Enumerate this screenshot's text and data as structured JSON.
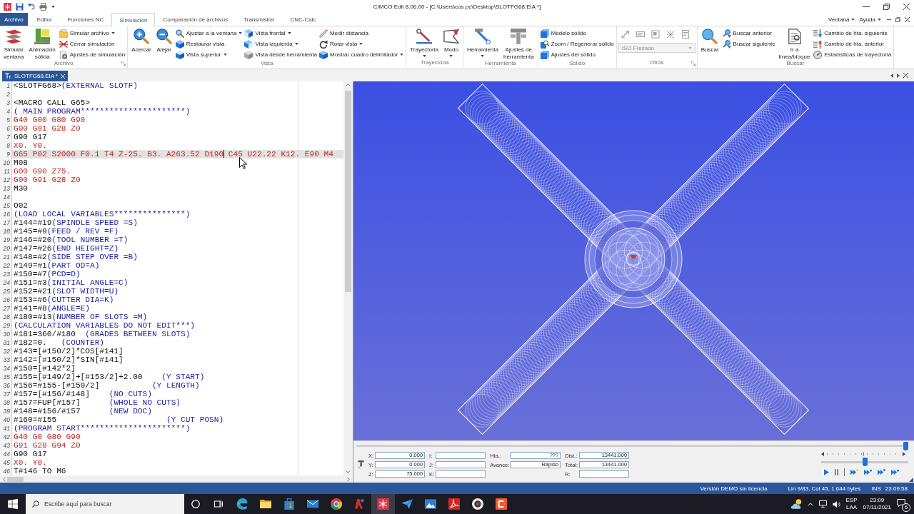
{
  "title_bar": {
    "title": "CIMCO Edit 8.06.00 - [C:\\Users\\cos pc\\Desktop\\SLOTFG68.EIA *]"
  },
  "ribbon": {
    "file_tab": "Archivo",
    "tabs": [
      {
        "label": "Editor",
        "selected": false
      },
      {
        "label": "Funciones NC",
        "selected": false
      },
      {
        "label": "Simulación",
        "selected": true
      },
      {
        "label": "Comparación de archivos",
        "selected": false
      },
      {
        "label": "Transmisión",
        "selected": false
      },
      {
        "label": "CNC-Calc",
        "selected": false
      }
    ],
    "menus": [
      {
        "label": "Ventana"
      },
      {
        "label": "Ayuda"
      }
    ],
    "groups": [
      {
        "label": "Archivo",
        "launcher": true,
        "items": [
          {
            "kind": "large",
            "label": "Simular ventana",
            "dropdown": false
          },
          {
            "kind": "large",
            "label": "Animación sólida",
            "dropdown": false
          },
          {
            "kind": "stack",
            "buttons": [
              {
                "label": "Simular archivo",
                "dropdown": true
              },
              {
                "label": "Cerrar simulación",
                "dropdown": false
              },
              {
                "label": "Ajustes de simulación",
                "dropdown": false
              }
            ]
          }
        ]
      },
      {
        "label": "Vista",
        "launcher": false,
        "items": [
          {
            "kind": "large",
            "label": "Acercar",
            "dropdown": false
          },
          {
            "kind": "large",
            "label": "Alejar",
            "dropdown": false
          },
          {
            "kind": "stack",
            "buttons": [
              {
                "label": "Ajustar a la ventana",
                "dropdown": true
              },
              {
                "label": "Restaurar vista",
                "dropdown": false
              },
              {
                "label": "Vista superior",
                "dropdown": true
              }
            ]
          },
          {
            "kind": "stack",
            "buttons": [
              {
                "label": "Vista frontal",
                "dropdown": true
              },
              {
                "label": "Vista izquierda",
                "dropdown": true
              },
              {
                "label": "Vista desde herramienta",
                "dropdown": false
              }
            ]
          },
          {
            "kind": "stack",
            "buttons": [
              {
                "label": "Medir distancia",
                "dropdown": false
              },
              {
                "label": "Rotar vista",
                "dropdown": true
              },
              {
                "label": "Mostrar cuadro delimitador",
                "dropdown": true
              }
            ]
          }
        ]
      },
      {
        "label": "Trayectoria",
        "launcher": false,
        "items": [
          {
            "kind": "large",
            "label": "Trayectoria",
            "dropdown": true
          },
          {
            "kind": "large",
            "label": "Modo",
            "dropdown": true
          }
        ]
      },
      {
        "label": "Herramienta",
        "launcher": false,
        "items": [
          {
            "kind": "large",
            "label": "Herramienta",
            "dropdown": true
          },
          {
            "kind": "large",
            "label": "Ajustes de herramienta",
            "dropdown": false
          }
        ]
      },
      {
        "label": "Sólido",
        "launcher": false,
        "items": [
          {
            "kind": "stack",
            "buttons": [
              {
                "label": "Modelo sólido",
                "dropdown": false
              },
              {
                "label": "Zoom / Regenerar sólido",
                "dropdown": false
              },
              {
                "label": "Ajustes del sólido",
                "dropdown": false
              }
            ]
          }
        ]
      },
      {
        "label": "Otros",
        "launcher": true,
        "items": [
          {
            "kind": "tools",
            "tools": [
              {
                "disabled": true
              },
              {
                "disabled": true
              },
              {
                "disabled": true
              },
              {
                "disabled": true
              },
              {
                "disabled": true
              }
            ],
            "combo": {
              "value": "ISO Fresado",
              "disabled": true
            }
          }
        ]
      },
      {
        "label": "Buscar",
        "launcher": false,
        "items": [
          {
            "kind": "large",
            "label": "Buscar",
            "dropdown": false
          },
          {
            "kind": "stack",
            "buttons": [
              {
                "label": "Buscar anterior",
                "dropdown": false
              },
              {
                "label": "Buscar siguiente",
                "dropdown": false
              }
            ]
          },
          {
            "kind": "large",
            "label": "Ir a línea/bloque",
            "dropdown": false
          },
          {
            "kind": "stack",
            "buttons": [
              {
                "label": "Cambio de hta. siguiente",
                "dropdown": false
              },
              {
                "label": "Cambio de hta. anterior",
                "dropdown": false
              },
              {
                "label": "Estadísticas de trayectoria",
                "dropdown": false
              }
            ]
          }
        ]
      }
    ]
  },
  "document_tabs": [
    {
      "label": "SLOTFG68.EIA *",
      "selected": true
    }
  ],
  "editor": {
    "lines": [
      {
        "number": "1",
        "current": false,
        "segments": [
          {
            "kind": "code",
            "text": "<SLOTFG68>"
          },
          {
            "kind": "comment",
            "text": "(EXTERNAL SLOTF)"
          }
        ]
      },
      {
        "number": "2",
        "current": false
      },
      {
        "number": "3",
        "current": false,
        "segments": [
          {
            "kind": "code",
            "text": "<MACRO CALL G65>"
          }
        ]
      },
      {
        "number": "4",
        "current": false,
        "segments": [
          {
            "kind": "comment",
            "text": "( MAIN PROGRAM**********************)"
          }
        ]
      },
      {
        "number": "5",
        "current": false,
        "segments": [
          {
            "kind": "gcode",
            "text": "G40 G00 G80 G90"
          }
        ]
      },
      {
        "number": "6",
        "current": false,
        "segments": [
          {
            "kind": "gcode",
            "text": "G00 G91 G28 Z0"
          }
        ]
      },
      {
        "number": "7",
        "current": false,
        "segments": [
          {
            "kind": "code",
            "text": "G90 G17"
          }
        ]
      },
      {
        "number": "8",
        "current": false,
        "segments": [
          {
            "kind": "gcode",
            "text": "X0. Y0."
          }
        ]
      },
      {
        "number": "9",
        "current": true,
        "segments": [
          {
            "kind": "gcode",
            "text": "G65 P02 S2000 F0.1 T4 Z-25. B3. A263.52 D190"
          },
          {
            "kind": "caret"
          },
          {
            "kind": "gcode",
            "text": " C45 U22.22 K12. E90 M4"
          }
        ]
      },
      {
        "number": "10",
        "current": false,
        "segments": [
          {
            "kind": "code",
            "text": "M08"
          }
        ]
      },
      {
        "number": "11",
        "current": false,
        "segments": [
          {
            "kind": "gcode",
            "text": "G00 G90 Z75."
          }
        ]
      },
      {
        "number": "12",
        "current": false,
        "segments": [
          {
            "kind": "gcode",
            "text": "G00 G91 G28 Z0"
          }
        ]
      },
      {
        "number": "13",
        "current": false,
        "segments": [
          {
            "kind": "code",
            "text": "M30"
          }
        ]
      },
      {
        "number": "14",
        "current": false
      },
      {
        "number": "15",
        "current": false,
        "segments": [
          {
            "kind": "code",
            "text": "O02"
          }
        ]
      },
      {
        "number": "16",
        "current": false,
        "segments": [
          {
            "kind": "comment",
            "text": "(LOAD LOCAL VARIABLES***************)"
          }
        ]
      },
      {
        "number": "17",
        "current": false,
        "segments": [
          {
            "kind": "code",
            "text": "#144=#19"
          },
          {
            "kind": "comment",
            "text": "(SPINDLE SPEED =S)"
          }
        ]
      },
      {
        "number": "18",
        "current": false,
        "segments": [
          {
            "kind": "code",
            "text": "#145=#9"
          },
          {
            "kind": "comment",
            "text": "(FEED / REV =F)"
          }
        ]
      },
      {
        "number": "19",
        "current": false,
        "segments": [
          {
            "kind": "code",
            "text": "#146=#20"
          },
          {
            "kind": "comment",
            "text": "(TOOL NUMBER =T)"
          }
        ]
      },
      {
        "number": "20",
        "current": false,
        "segments": [
          {
            "kind": "code",
            "text": "#147=#26"
          },
          {
            "kind": "comment",
            "text": "(END HEIGHT=Z)"
          }
        ]
      },
      {
        "number": "21",
        "current": false,
        "segments": [
          {
            "kind": "code",
            "text": "#148=#2"
          },
          {
            "kind": "comment",
            "text": "(SIDE STEP OVER =B)"
          }
        ]
      },
      {
        "number": "22",
        "current": false,
        "segments": [
          {
            "kind": "code",
            "text": "#149=#1"
          },
          {
            "kind": "comment",
            "text": "(PART OD=A)"
          }
        ]
      },
      {
        "number": "23",
        "current": false,
        "segments": [
          {
            "kind": "code",
            "text": "#150=#7"
          },
          {
            "kind": "comment",
            "text": "(PCD=D)"
          }
        ]
      },
      {
        "number": "24",
        "current": false,
        "segments": [
          {
            "kind": "code",
            "text": "#151=#3"
          },
          {
            "kind": "comment",
            "text": "(INITIAL ANGLE=C)"
          }
        ]
      },
      {
        "number": "25",
        "current": false,
        "segments": [
          {
            "kind": "code",
            "text": "#152=#21"
          },
          {
            "kind": "comment",
            "text": "(SLOT WIDTH=U)"
          }
        ]
      },
      {
        "number": "26",
        "current": false,
        "segments": [
          {
            "kind": "code",
            "text": "#153=#6"
          },
          {
            "kind": "comment",
            "text": "(CUTTER DIA=K)"
          }
        ]
      },
      {
        "number": "27",
        "current": false,
        "segments": [
          {
            "kind": "code",
            "text": "#141=#8"
          },
          {
            "kind": "comment",
            "text": "(ANGLE=E)"
          }
        ]
      },
      {
        "number": "28",
        "current": false,
        "segments": [
          {
            "kind": "code",
            "text": "#180=#13"
          },
          {
            "kind": "comment",
            "text": "(NUMBER OF SLOTS =M)"
          }
        ]
      },
      {
        "number": "29",
        "current": false,
        "segments": [
          {
            "kind": "comment",
            "text": "(CALCULATION VARIABLES DO NOT EDIT***)"
          }
        ]
      },
      {
        "number": "30",
        "current": false,
        "segments": [
          {
            "kind": "code",
            "text": "#181=360/#180"
          },
          {
            "kind": "comment",
            "text": "  (GRADES BETWEEN SLOTS)"
          }
        ]
      },
      {
        "number": "31",
        "current": false,
        "segments": [
          {
            "kind": "code",
            "text": "#182=0."
          },
          {
            "kind": "comment",
            "text": "   (COUNTER)"
          }
        ]
      },
      {
        "number": "32",
        "current": false,
        "segments": [
          {
            "kind": "code",
            "text": "#143=[#150/2]*COS[#141]"
          }
        ]
      },
      {
        "number": "33",
        "current": false,
        "segments": [
          {
            "kind": "code",
            "text": "#142=[#150/2]*SIN[#141]"
          }
        ]
      },
      {
        "number": "34",
        "current": false,
        "segments": [
          {
            "kind": "code",
            "text": "#150=[#142*2]"
          }
        ]
      },
      {
        "number": "35",
        "current": false,
        "segments": [
          {
            "kind": "code",
            "text": "#155=[#149/2]+[#153/2]+2.00"
          },
          {
            "kind": "comment",
            "text": "    (Y START)"
          }
        ]
      },
      {
        "number": "36",
        "current": false,
        "segments": [
          {
            "kind": "code",
            "text": "#156=#155-[#150/2]"
          },
          {
            "kind": "comment",
            "text": "           (Y LENGTH)"
          }
        ]
      },
      {
        "number": "37",
        "current": false,
        "segments": [
          {
            "kind": "code",
            "text": "#157=[#156/#148]"
          },
          {
            "kind": "comment",
            "text": "    (NO CUTS)"
          }
        ]
      },
      {
        "number": "38",
        "current": false,
        "segments": [
          {
            "kind": "code",
            "text": "#157=FUP[#157]"
          },
          {
            "kind": "comment",
            "text": "      (WHOLE NO CUTS)"
          }
        ]
      },
      {
        "number": "39",
        "current": false,
        "segments": [
          {
            "kind": "code",
            "text": "#148=#156/#157"
          },
          {
            "kind": "comment",
            "text": "      (NEW DOC)"
          }
        ]
      },
      {
        "number": "40",
        "current": false,
        "segments": [
          {
            "kind": "code",
            "text": "#160=#155"
          },
          {
            "kind": "comment",
            "text": "                       (Y CUT POSN)"
          }
        ]
      },
      {
        "number": "41",
        "current": false,
        "segments": [
          {
            "kind": "comment",
            "text": "(PROGRAM START**********************)"
          }
        ]
      },
      {
        "number": "42",
        "current": false,
        "segments": [
          {
            "kind": "gcode",
            "text": "G40 G0 G80 G90"
          }
        ]
      },
      {
        "number": "43",
        "current": false,
        "segments": [
          {
            "kind": "gcode",
            "text": "G91 G28 G94 Z0"
          }
        ]
      },
      {
        "number": "44",
        "current": false,
        "segments": [
          {
            "kind": "code",
            "text": "G90 G17"
          }
        ]
      },
      {
        "number": "45",
        "current": false,
        "segments": [
          {
            "kind": "gcode",
            "text": "X0. Y0."
          }
        ]
      },
      {
        "number": "46",
        "current": false,
        "segments": [
          {
            "kind": "code",
            "text": "T#146 TO M6"
          }
        ]
      }
    ]
  },
  "simulation": {
    "progress": {
      "level": 1
    },
    "columns": [
      {
        "fields": [
          {
            "label": "X:",
            "value": "0.000"
          },
          {
            "label": "Y:",
            "value": "0.000"
          },
          {
            "label": "Z:",
            "value": "75.000"
          }
        ]
      },
      {
        "fields": [
          {
            "label": "I:"
          },
          {
            "label": "J:"
          },
          {
            "label": "K:"
          }
        ]
      },
      {
        "fields": [
          {
            "label": "Hta.:",
            "value": "???"
          },
          {
            "label": "Avance:",
            "value": "Rápido"
          }
        ]
      },
      {
        "fields": [
          {
            "label": "Dist.:",
            "value": "13441.000"
          },
          {
            "label": "Total:",
            "value": "13441.000"
          },
          {
            "label": "R:"
          }
        ]
      }
    ],
    "speed": {
      "level": 0.5
    }
  },
  "status_bar": {
    "message": "Versión DEMO sin licencia",
    "position": "Lin 9/83, Col 45, 1.644 bytes",
    "mode": "INS",
    "time": "23:09:58"
  },
  "taskbar": {
    "search": {
      "placeholder": "Escribe aquí para buscar"
    },
    "apps": [
      {
        "selected": false
      },
      {
        "selected": false
      },
      {
        "selected": false
      },
      {
        "selected": false
      },
      {
        "selected": false
      },
      {
        "selected": false
      },
      {
        "selected": true
      },
      {
        "selected": false
      },
      {
        "selected": false
      },
      {
        "selected": false
      },
      {
        "selected": false
      },
      {
        "selected": false
      }
    ],
    "language": "ESP",
    "layout": "LAA",
    "time": "23:09",
    "date": "07/11/2021",
    "notification_count": "6"
  }
}
